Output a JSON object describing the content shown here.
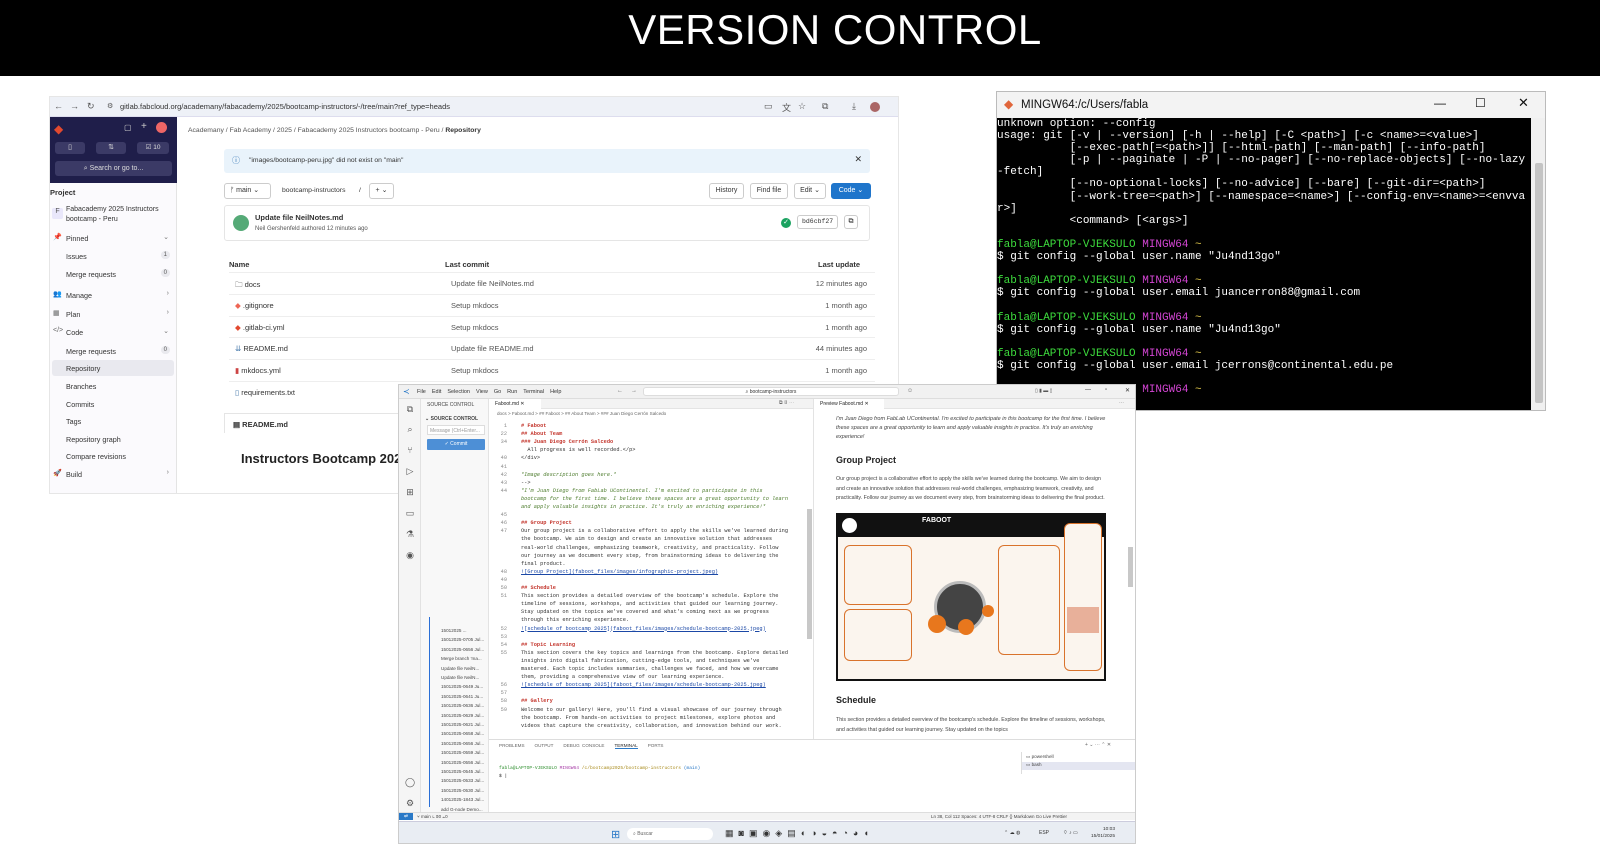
{
  "banner": {
    "title": "VERSION CONTROL"
  },
  "gitlab": {
    "url": "gitlab.fabcloud.org/academany/fabacademy/2025/bootcamp-instructors/-/tree/main?ref_type=heads",
    "search_placeholder": "Search or go to...",
    "top_counts": {
      "mr_count": "10"
    },
    "breadcrumb": [
      "Academany",
      "Fab Academy",
      "2025",
      "Fabacademy 2025 Instructors bootcamp - Peru",
      "Repository"
    ],
    "alert": "\"images/bootcamp-peru.jpg\" did not exist on \"main\"",
    "branch": "main",
    "path": "bootcamp-instructors",
    "buttons": {
      "history": "History",
      "find_file": "Find file",
      "edit": "Edit",
      "code": "Code"
    },
    "sidebar": {
      "heading": "Project",
      "project_name": "Fabacademy 2025 Instructors bootcamp - Peru",
      "project_initial": "F",
      "items": [
        {
          "label": "Pinned",
          "count": ""
        },
        {
          "label": "Issues",
          "count": "1"
        },
        {
          "label": "Merge requests",
          "count": "0"
        },
        {
          "label": "Manage",
          "count": ""
        },
        {
          "label": "Plan",
          "count": ""
        },
        {
          "label": "Code",
          "count": ""
        },
        {
          "label": "Merge requests",
          "count": "0"
        },
        {
          "label": "Repository",
          "count": ""
        },
        {
          "label": "Branches",
          "count": ""
        },
        {
          "label": "Commits",
          "count": ""
        },
        {
          "label": "Tags",
          "count": ""
        },
        {
          "label": "Repository graph",
          "count": ""
        },
        {
          "label": "Compare revisions",
          "count": ""
        },
        {
          "label": "Build",
          "count": ""
        }
      ]
    },
    "commit": {
      "title": "Update file NeilNotes.md",
      "author": "Neil Gershenfeld",
      "meta": "authored 12 minutes ago",
      "sha": "bd6cbf27"
    },
    "table": {
      "headers": [
        "Name",
        "Last commit",
        "Last update"
      ],
      "rows": [
        {
          "name": "docs",
          "commit": "Update file NeilNotes.md",
          "updated": "12 minutes ago"
        },
        {
          "name": ".gitignore",
          "commit": "Setup mkdocs",
          "updated": "1 month ago"
        },
        {
          "name": ".gitlab-ci.yml",
          "commit": "Setup mkdocs",
          "updated": "1 month ago"
        },
        {
          "name": "README.md",
          "commit": "Update file README.md",
          "updated": "44 minutes ago"
        },
        {
          "name": "mkdocs.yml",
          "commit": "Setup mkdocs",
          "updated": "1 month ago"
        },
        {
          "name": "requirements.txt",
          "commit": "",
          "updated": ""
        }
      ]
    },
    "readme_label": "README.md",
    "readme_title": "Instructors Bootcamp 2025"
  },
  "terminal": {
    "title": "MINGW64:/c/Users/fabla",
    "lines": [
      [
        {
          "t": "unknown option: --config"
        }
      ],
      [
        {
          "t": "usage: git [-v | --version] [-h | --help] [-C <path>] [-c <name>=<value>]"
        }
      ],
      [
        {
          "t": "           [--exec-path[=<path>]] [--html-path] [--man-path] [--info-path]"
        }
      ],
      [
        {
          "t": "           [-p | --paginate | -P | --no-pager] [--no-replace-objects] [--no-lazy"
        }
      ],
      [
        {
          "t": "-fetch]"
        }
      ],
      [
        {
          "t": "           [--no-optional-locks] [--no-advice] [--bare] [--git-dir=<path>]"
        }
      ],
      [
        {
          "t": "           [--work-tree=<path>] [--namespace=<name>] [--config-env=<name>=<envva"
        }
      ],
      [
        {
          "t": "r>]"
        }
      ],
      [
        {
          "t": "           <command> [<args>]"
        }
      ],
      [
        {
          "t": ""
        }
      ],
      [
        {
          "t": "fabla@LAPTOP-VJEKSULO ",
          "c": "tg"
        },
        {
          "t": "MINGW64 ",
          "c": "tm"
        },
        {
          "t": "~",
          "c": "ty"
        }
      ],
      [
        {
          "t": "$ git config --global user.name \"Ju4nd13go\""
        }
      ],
      [
        {
          "t": ""
        }
      ],
      [
        {
          "t": "fabla@LAPTOP-VJEKSULO ",
          "c": "tg"
        },
        {
          "t": "MINGW64 ",
          "c": "tm"
        },
        {
          "t": "~",
          "c": "ty"
        }
      ],
      [
        {
          "t": "$ git config --global user.email juancerron88@gmail.com"
        }
      ],
      [
        {
          "t": ""
        }
      ],
      [
        {
          "t": "fabla@LAPTOP-VJEKSULO ",
          "c": "tg"
        },
        {
          "t": "MINGW64 ",
          "c": "tm"
        },
        {
          "t": "~",
          "c": "ty"
        }
      ],
      [
        {
          "t": "$ git config --global user.name \"Ju4nd13go\""
        }
      ],
      [
        {
          "t": ""
        }
      ],
      [
        {
          "t": "fabla@LAPTOP-VJEKSULO ",
          "c": "tg"
        },
        {
          "t": "MINGW64 ",
          "c": "tm"
        },
        {
          "t": "~",
          "c": "ty"
        }
      ],
      [
        {
          "t": "$ git config --global user.email jcerrons@continental.edu.pe"
        }
      ],
      [
        {
          "t": ""
        }
      ],
      [
        {
          "t": "                      "
        },
        {
          "t": "MINGW64 ",
          "c": "tm"
        },
        {
          "t": "~",
          "c": "ty"
        }
      ]
    ]
  },
  "vscode": {
    "menu": [
      "File",
      "Edit",
      "Selection",
      "View",
      "Go",
      "Run",
      "Terminal",
      "Help"
    ],
    "search": "bootcamp-instructors",
    "source_control": {
      "title": "SOURCE CONTROL",
      "section": "SOURCE CONTROL",
      "message_placeholder": "Message (Ctrl+Enter...",
      "commit_label": "✓ Commit"
    },
    "commits": [
      "15012025 ...",
      "15012025-0705 Jul...",
      "15012025-0656 Jul...",
      "Merge branch 'ma...",
      "Update file NeilN...",
      "Update file NeilN...",
      "15012025-0649 Ju...",
      "15012025-0641 Ju...",
      "15012025-0636 Jul...",
      "15012025-0629 Jul...",
      "15012025-0621 Jul...",
      "15012025-0658 Jul...",
      "15012025-0656 Jul...",
      "15012025-0559 Jul...",
      "15012025-0556 Jul...",
      "15012025-0545 Jul...",
      "15012025-0533 Jul...",
      "15012025-0530 Jul...",
      "14012025-1843 Jul...",
      "add G-node Demo..."
    ],
    "editor_tab": "Faboot.md",
    "editor_breadcrumb": "docs > Faboot.md > ## Faboot > ## About Team > ### Juan Diego Cerrón Salcedo",
    "preview_tab": "Preview Faboot.md",
    "editor_lines": [
      {
        "n": "1",
        "t": "# Faboot",
        "k": "md-h"
      },
      {
        "n": "22",
        "t": "## About Team",
        "k": "md-h"
      },
      {
        "n": "34",
        "t": "### Juan Diego Cerrón Salcedo",
        "k": "md-h"
      },
      {
        "n": "",
        "t": "  All progress is well recorded.</p>",
        "k": ""
      },
      {
        "n": "40",
        "t": "</div>",
        "k": ""
      },
      {
        "n": "41",
        "t": "",
        "k": ""
      },
      {
        "n": "42",
        "t": "*Image description goes here.*",
        "k": "md-i"
      },
      {
        "n": "43",
        "t": "-->",
        "k": ""
      },
      {
        "n": "44",
        "t": "*I'm Juan Diego from FabLab UContinental. I'm excited to participate in this",
        "k": "md-i"
      },
      {
        "n": "",
        "t": "bootcamp for the first time. I believe these spaces are a great opportunity to learn",
        "k": "md-i"
      },
      {
        "n": "",
        "t": "and apply valuable insights in practice. It's truly an enriching experience!*",
        "k": "md-i"
      },
      {
        "n": "45",
        "t": "",
        "k": ""
      },
      {
        "n": "46",
        "t": "## Group Project",
        "k": "md-h"
      },
      {
        "n": "47",
        "t": "Our group project is a collaborative effort to apply the skills we've learned during",
        "k": ""
      },
      {
        "n": "",
        "t": "the bootcamp. We aim to design and create an innovative solution that addresses",
        "k": ""
      },
      {
        "n": "",
        "t": "real-world challenges, emphasizing teamwork, creativity, and practicality. Follow",
        "k": ""
      },
      {
        "n": "",
        "t": "our journey as we document every step, from brainstorming ideas to delivering the",
        "k": ""
      },
      {
        "n": "",
        "t": "final product.",
        "k": ""
      },
      {
        "n": "48",
        "t": "![Group Project](faboot_files/images/infographic-project.jpeg)",
        "k": "md-l"
      },
      {
        "n": "49",
        "t": "",
        "k": ""
      },
      {
        "n": "50",
        "t": "## Schedule",
        "k": "md-h"
      },
      {
        "n": "51",
        "t": "This section provides a detailed overview of the bootcamp's schedule. Explore the",
        "k": ""
      },
      {
        "n": "",
        "t": "timeline of sessions, workshops, and activities that guided our learning journey.",
        "k": ""
      },
      {
        "n": "",
        "t": "Stay updated on the topics we've covered and what's coming next as we progress",
        "k": ""
      },
      {
        "n": "",
        "t": "through this enriching experience.",
        "k": ""
      },
      {
        "n": "52",
        "t": "![schedule of bootcamp 2025](faboot_files/images/schedule-bootcamp-2025.jpeg)",
        "k": "md-l"
      },
      {
        "n": "53",
        "t": "",
        "k": ""
      },
      {
        "n": "54",
        "t": "## Topic Learning",
        "k": "md-h"
      },
      {
        "n": "55",
        "t": "This section covers the key topics and learnings from the bootcamp. Explore detailed",
        "k": ""
      },
      {
        "n": "",
        "t": "insights into digital fabrication, cutting-edge tools, and techniques we've",
        "k": ""
      },
      {
        "n": "",
        "t": "mastered. Each topic includes summaries, challenges we faced, and how we overcame",
        "k": ""
      },
      {
        "n": "",
        "t": "them, providing a comprehensive view of our learning experience.",
        "k": ""
      },
      {
        "n": "56",
        "t": "![schedule of bootcamp 2025](faboot_files/images/schedule-bootcamp-2025.jpeg)",
        "k": "md-l"
      },
      {
        "n": "57",
        "t": "",
        "k": ""
      },
      {
        "n": "58",
        "t": "## Gallery",
        "k": "md-h"
      },
      {
        "n": "59",
        "t": "Welcome to our gallery! Here, you'll find a visual showcase of our journey through",
        "k": ""
      },
      {
        "n": "",
        "t": "the bootcamp. From hands-on activities to project milestones, explore photos and",
        "k": ""
      },
      {
        "n": "",
        "t": "videos that capture the creativity, collaboration, and innovation behind our work.",
        "k": ""
      }
    ],
    "preview": {
      "intro": "I'm Juan Diego from FabLab UContinental. I'm excited to participate in this bootcamp for the first time. I believe these spaces are a great opportunity to learn and apply valuable insights in practice. It's truly an enriching experience!",
      "group_heading": "Group Project",
      "group_text": "Our group project is a collaborative effort to apply the skills we've learned during the bootcamp. We aim to design and create an innovative solution that addresses real-world challenges, emphasizing teamwork, creativity, and practicality. Follow our journey as we document every step, from brainstorming ideas to delivering the final product.",
      "poster_title": "FABOOT",
      "schedule_heading": "Schedule",
      "schedule_text": "This section provides a detailed overview of the bootcamp's schedule. Explore the timeline of sessions, workshops, and activities that guided our learning journey. Stay updated on the topics"
    },
    "panel_tabs": [
      "PROBLEMS",
      "OUTPUT",
      "DEBUG CONSOLE",
      "TERMINAL",
      "PORTS"
    ],
    "terminal_prompt": {
      "user": "fabla@LAPTOP-VJEKSULO",
      "shell": "MINGW64",
      "path": "/c/bootcamp2025/bootcamp-instructors",
      "branch": "(main)",
      "cmd": "$ |"
    },
    "shells": [
      "powershell",
      "bash"
    ],
    "status_left": "main",
    "status_right": "Ln 38, Col 112   Spaces: 4   UTF-8   CRLF   {} Markdown   Go Live   Prettier",
    "taskbar_search": "Buscar",
    "clock_time": "10:03",
    "clock_date": "15/01/2025",
    "lang": "ESP"
  }
}
